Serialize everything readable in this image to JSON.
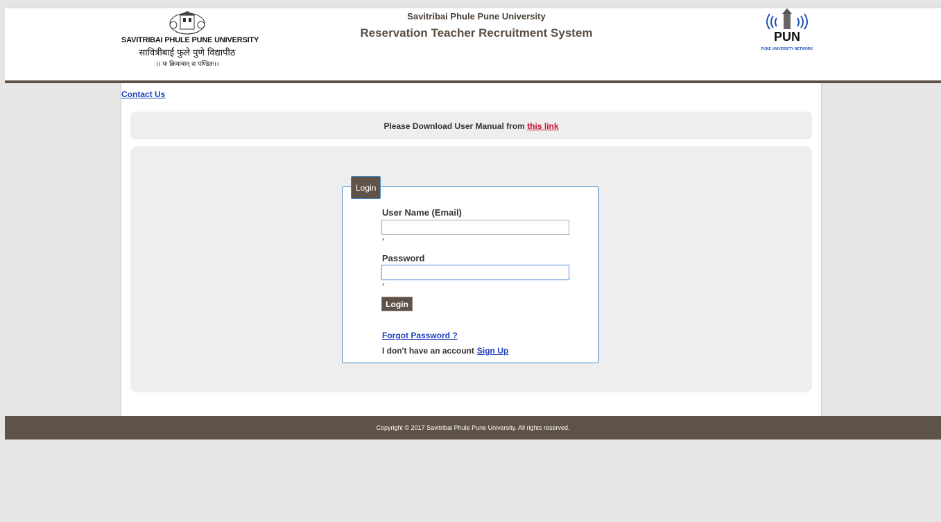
{
  "header": {
    "university_name_en": "SAVITRIBAI PHULE PUNE UNIVERSITY",
    "university_name_mr": "सावित्रीबाई फुले पुणे विद्यापीठ",
    "motto": "।। यः क्रियावान् स पण्डितः।।",
    "title_university": "Savitribai Phule Pune University",
    "title_system": "Reservation Teacher Recruitment System",
    "right_logo_text": "PUN",
    "right_logo_caption": "PUNE UNIVERSITY NETWORK"
  },
  "nav": {
    "contact_label": "Contact Us"
  },
  "notice": {
    "text": "Please Download User Manual from ",
    "link_label": "this link"
  },
  "login": {
    "legend": "Login",
    "username_label": "User Name (Email)",
    "username_value": "",
    "password_label": "Password",
    "password_value": "",
    "required_mark": "*",
    "submit_label": "Login",
    "forgot_label": "Forgot Password ?",
    "no_account_text": "I don't have an account",
    "signup_label": "Sign Up"
  },
  "footer": {
    "copyright": "Copyright © 2017 Savitribai Phule Pune University. All rights reserved."
  },
  "colors": {
    "brand_brown": "#5f5248",
    "link_blue": "#1f3fbf",
    "link_red": "#c8102e",
    "panel_gray": "#eeeeee",
    "box_border_blue": "#3a86c8"
  },
  "icons": {
    "left_logo": "university-emblem-icon",
    "right_logo": "pun-network-logo-icon"
  }
}
